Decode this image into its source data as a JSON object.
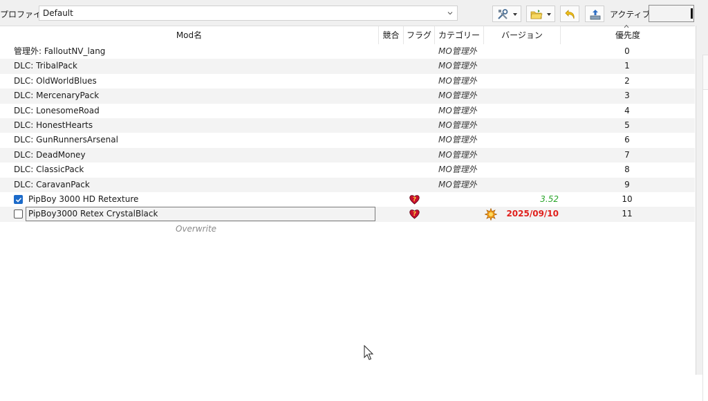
{
  "toolbar": {
    "profile_label": "プロファイル",
    "profile_value": "Default",
    "active_label": "アクティブ:"
  },
  "table": {
    "columns": [
      "Mod名",
      "競合",
      "フラグ",
      "カテゴリー",
      "バージョン",
      "優先度"
    ],
    "rows": [
      {
        "name": "管理外: FalloutNV_lang",
        "category": "MO管理外",
        "version": "",
        "priority": "0"
      },
      {
        "name": "DLC: TribalPack",
        "category": "MO管理外",
        "version": "",
        "priority": "1"
      },
      {
        "name": "DLC: OldWorldBlues",
        "category": "MO管理外",
        "version": "",
        "priority": "2"
      },
      {
        "name": "DLC: MercenaryPack",
        "category": "MO管理外",
        "version": "",
        "priority": "3"
      },
      {
        "name": "DLC: LonesomeRoad",
        "category": "MO管理外",
        "version": "",
        "priority": "4"
      },
      {
        "name": "DLC: HonestHearts",
        "category": "MO管理外",
        "version": "",
        "priority": "5"
      },
      {
        "name": "DLC: GunRunnersArsenal",
        "category": "MO管理外",
        "version": "",
        "priority": "6"
      },
      {
        "name": "DLC: DeadMoney",
        "category": "MO管理外",
        "version": "",
        "priority": "7"
      },
      {
        "name": "DLC: ClassicPack",
        "category": "MO管理外",
        "version": "",
        "priority": "8"
      },
      {
        "name": "DLC: CaravanPack",
        "category": "MO管理外",
        "version": "",
        "priority": "9"
      },
      {
        "name": "PipBoy 3000 HD Retexture",
        "checked": true,
        "flag_icon": "heart-question-icon",
        "version": "3.52",
        "version_color": "#2aa52a",
        "priority": "10"
      },
      {
        "name": "PipBoy3000 Retex CrystalBlack",
        "checked": false,
        "flag_icon": "heart-question-icon",
        "version_icon": "warning-burst-icon",
        "version": "2025/09/10",
        "version_color": "#e0201c",
        "priority": "11"
      }
    ],
    "overwrite_label": "Overwrite"
  },
  "colors": {
    "row_alt": "#f3f3f3",
    "check_blue": "#1b6ac9",
    "version_green": "#2aa52a",
    "version_red": "#e0201c"
  }
}
